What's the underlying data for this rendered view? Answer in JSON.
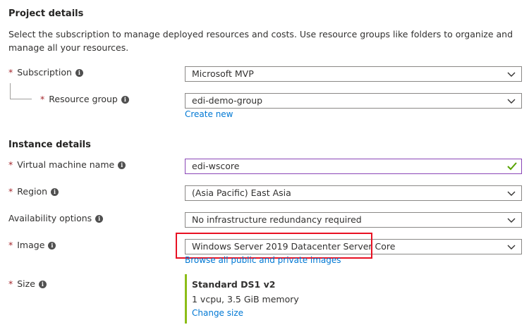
{
  "project": {
    "title": "Project details",
    "description": "Select the subscription to manage deployed resources and costs. Use resource groups like folders to organize and manage all your resources.",
    "subscription": {
      "label": "Subscription",
      "value": "Microsoft MVP"
    },
    "resource_group": {
      "label": "Resource group",
      "value": "edi-demo-group",
      "create_new": "Create new"
    }
  },
  "instance": {
    "title": "Instance details",
    "vm_name": {
      "label": "Virtual machine name",
      "value": "edi-wscore"
    },
    "region": {
      "label": "Region",
      "value": "(Asia Pacific) East Asia"
    },
    "availability": {
      "label": "Availability options",
      "value": "No infrastructure redundancy required"
    },
    "image": {
      "label": "Image",
      "value": "Windows Server 2019 Datacenter Server Core",
      "browse": "Browse all public and private images"
    },
    "size": {
      "label": "Size",
      "name": "Standard DS1 v2",
      "specs": "1 vcpu, 3.5 GiB memory",
      "change": "Change size"
    }
  },
  "required_mark": "*",
  "info_glyph": "i",
  "colors": {
    "link": "#0078d4",
    "required": "#a4262c",
    "valid_check": "#57a300",
    "highlight": "#e81123",
    "size_accent": "#8cbd18"
  }
}
